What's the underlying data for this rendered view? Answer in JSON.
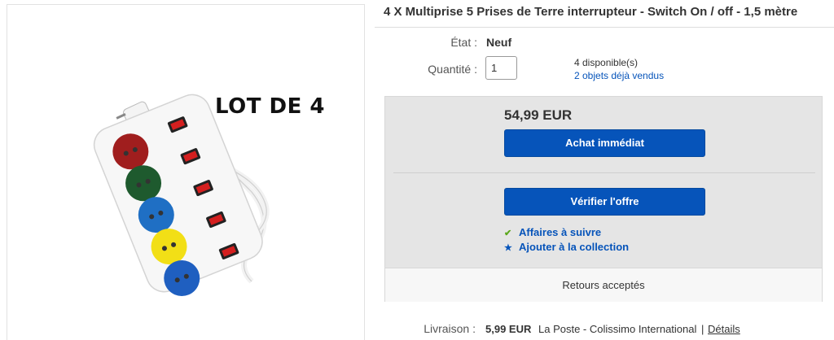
{
  "product": {
    "title": "4 X Multiprise 5 Prises de Terre interrupteur - Switch On / off - 1,5 mètre",
    "image_overlay_text": "LOT DE 4"
  },
  "details": {
    "condition_label": "État :",
    "condition_value": "Neuf",
    "quantity_label": "Quantité :",
    "quantity_value": "1",
    "available_text": "4 disponible(s)",
    "sold_text": "2 objets déjà vendus"
  },
  "buy_box": {
    "price": "54,99 EUR",
    "buy_now_label": "Achat immédiat",
    "see_offer_label": "Vérifier l'offre",
    "watch_label": "Affaires à suivre",
    "collection_label": "Ajouter à la collection",
    "returns_text": "Retours acceptés"
  },
  "shipping": {
    "label": "Livraison :",
    "price": "5,99 EUR",
    "carrier": "La Poste - Colissimo International",
    "separator": "|",
    "details_label": "Détails"
  },
  "icons": {
    "watch": "check-icon",
    "collection": "star-icon"
  },
  "colors": {
    "button_blue": "#0654ba",
    "link_blue": "#0654ba",
    "check_green": "#5ba71b",
    "box_gray": "#e5e5e5",
    "socket_colors": [
      "#a01e1e",
      "#1e5a2e",
      "#1f6fc4",
      "#f2df16",
      "#1f5fc0"
    ]
  }
}
